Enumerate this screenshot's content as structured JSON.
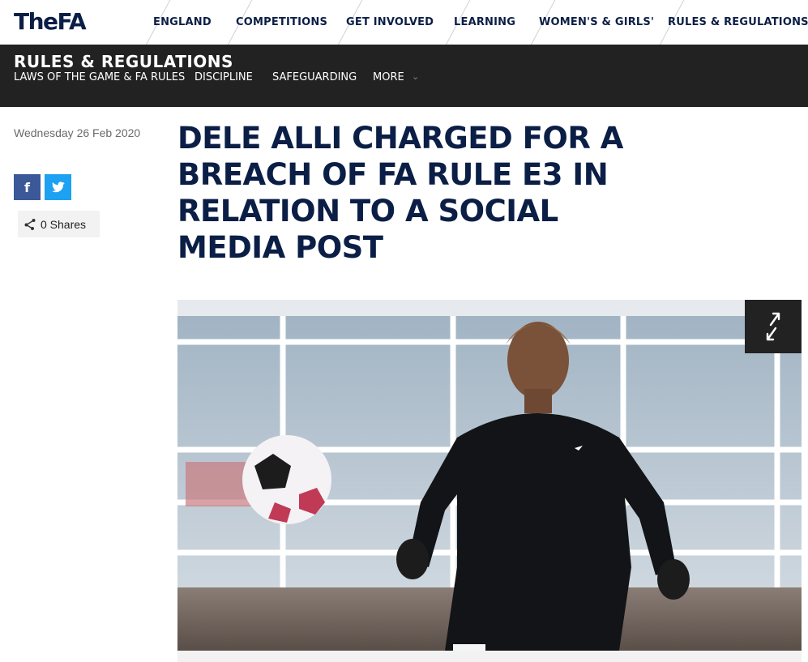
{
  "brand": {
    "logo_text": "TheFA"
  },
  "top_nav": {
    "items": [
      "ENGLAND",
      "COMPETITIONS",
      "GET INVOLVED",
      "LEARNING",
      "WOMEN'S & GIRLS'",
      "RULES & REGULATIONS"
    ]
  },
  "section": {
    "title": "RULES & REGULATIONS",
    "sub_nav": [
      "LAWS OF THE GAME & FA RULES",
      "DISCIPLINE",
      "SAFEGUARDING",
      "MORE"
    ]
  },
  "article": {
    "date": "Wednesday 26 Feb 2020",
    "headline": "DELE ALLI CHARGED FOR A BREACH OF FA RULE E3 IN RELATION TO A SOCIAL MEDIA POST",
    "shares_label": "0 Shares"
  },
  "icons": {
    "facebook": "facebook-icon",
    "twitter": "twitter-icon",
    "share": "share-icon",
    "expand": "expand-icon",
    "dropdown": "chevron-down-icon"
  },
  "colors": {
    "brand_navy": "#0b1e46",
    "subbar_bg": "#222222",
    "facebook": "#3b5998",
    "twitter": "#1da1f2"
  }
}
